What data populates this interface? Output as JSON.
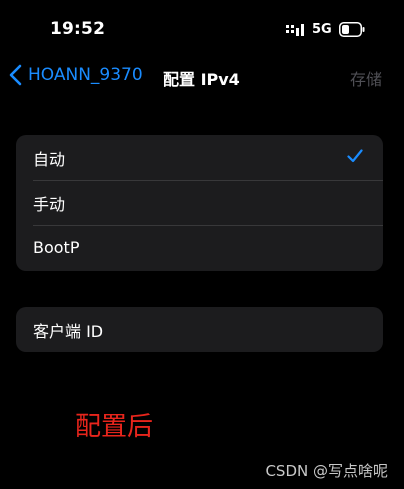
{
  "status_bar": {
    "time": "19:52",
    "network": "5G",
    "icons": [
      "signal-bars-icon",
      "battery-icon"
    ]
  },
  "nav": {
    "back_label": "HOANN_9370",
    "title": "配置 IPv4",
    "save_label": "存储",
    "back_icon": "chevron-left-icon"
  },
  "options": {
    "items": [
      {
        "label": "自动",
        "selected": true
      },
      {
        "label": "手动",
        "selected": false
      },
      {
        "label": "BootP",
        "selected": false
      }
    ],
    "check_icon": "checkmark-icon"
  },
  "client": {
    "label": "客户端 ID"
  },
  "annotation": "配置后",
  "watermark": "CSDN @写点啥呢",
  "colors": {
    "accent": "#1a8cff",
    "background": "#000000",
    "cell": "#1c1c1e",
    "disabled": "#4f4f55",
    "annotation": "#e8251c"
  }
}
